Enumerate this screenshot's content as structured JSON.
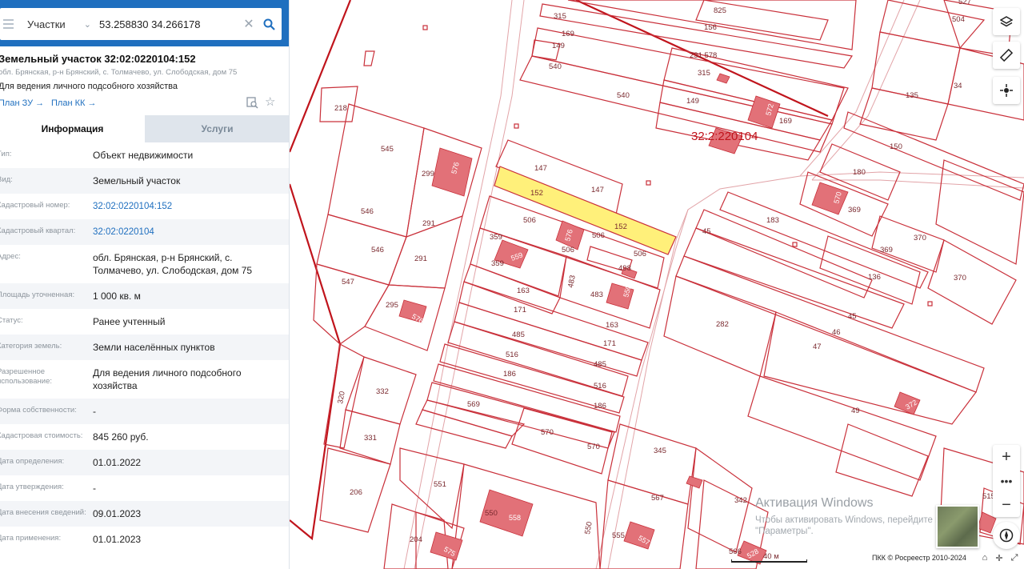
{
  "search": {
    "type_label": "Участки",
    "query": "53.258830 34.266178"
  },
  "object": {
    "title": "Земельный участок 32:02:0220104:152",
    "address_short": "обл. Брянская, р-н Брянский, с. Толмачево, ул. Слободская, дом 75",
    "purpose": "Для ведения личного подсобного хозяйства",
    "plan_zu": "План ЗУ",
    "plan_kk": "План КК"
  },
  "tabs": [
    "Информация",
    "Услуги"
  ],
  "info_rows": [
    {
      "key": "Тип:",
      "value": "Объект недвижимости"
    },
    {
      "key": "Вид:",
      "value": "Земельный участок"
    },
    {
      "key": "Кадастровый номер:",
      "value": "32:02:0220104:152"
    },
    {
      "key": "Кадастровый квартал:",
      "value": "32:02:0220104"
    },
    {
      "key": "Адрес:",
      "value": "обл. Брянская, р-н Брянский, с. Толмачево, ул. Слободская, дом 75"
    },
    {
      "key": "Площадь уточненная:",
      "value": "1 000 кв. м"
    },
    {
      "key": "Статус:",
      "value": "Ранее учтенный"
    },
    {
      "key": "Категория земель:",
      "value": "Земли населённых пунктов"
    },
    {
      "key": "Разрешенное использование:",
      "value": "Для ведения личного подсобного хозяйства"
    },
    {
      "key": "Форма собственности:",
      "value": "-"
    },
    {
      "key": "Кадастровая стоимость:",
      "value": "845 260 руб."
    },
    {
      "key": "Дата определения:",
      "value": "01.01.2022"
    },
    {
      "key": "Дата утверждения:",
      "value": "-"
    },
    {
      "key": "Дата внесения сведений:",
      "value": "09.01.2023"
    },
    {
      "key": "Дата применения:",
      "value": "01.01.2023"
    }
  ],
  "map": {
    "quarter_label": "32:2:220104",
    "selected_parcel": "152",
    "scale_label": "40 м",
    "copyright": "ПКК © Росреестр 2010-2024",
    "watermark_title": "Активация Windows",
    "watermark_text": "Чтобы активировать Windows, перейдите в раздел \"Параметры\"."
  },
  "colors": {
    "header_blue": "#1f6fbf",
    "parcel_stroke": "#c9303a",
    "selected_fill": "#fff07a",
    "building_fill": "#e27178"
  },
  "icons": [
    "menu-icon",
    "chevron-down-icon",
    "close-icon",
    "search-icon",
    "chevron-left-icon",
    "layers-icon",
    "ruler-icon",
    "locate-icon",
    "plus-icon",
    "more-icon",
    "minus-icon",
    "compass-icon",
    "home-icon"
  ]
}
